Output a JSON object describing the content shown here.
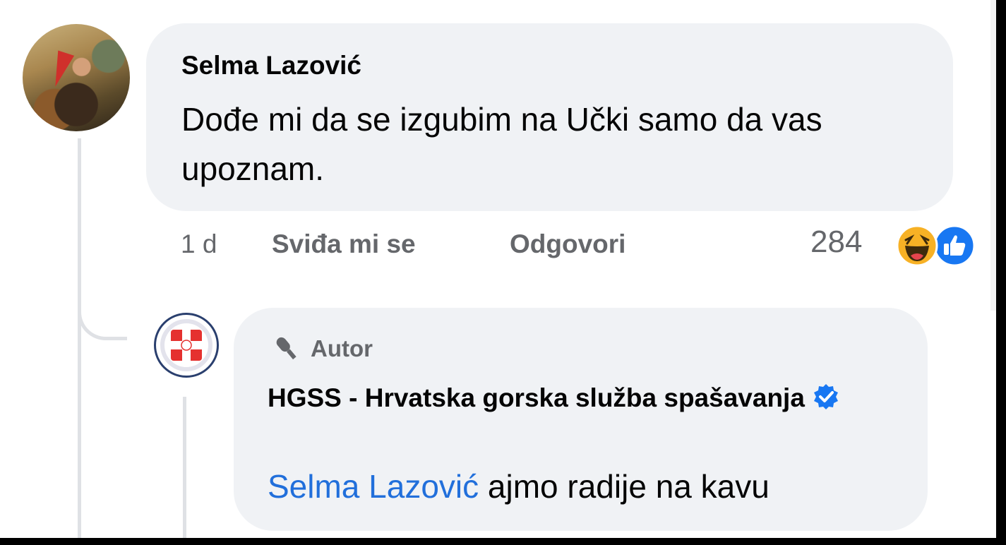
{
  "comment": {
    "author": "Selma Lazović",
    "text": "Dođe mi da se izgubim na Učki samo da vas upoznam.",
    "time": "1 d",
    "like_label": "Sviđa mi se",
    "reply_label": "Odgovori",
    "reaction_count": "284",
    "reactions": [
      "haha-icon",
      "like-icon"
    ]
  },
  "reply": {
    "badge": "Autor",
    "author": "HGSS - Hrvatska gorska služba spašavanja",
    "verified": true,
    "mention": "Selma Lazović",
    "text": " ajmo radije na kavu"
  },
  "colors": {
    "bubble": "#f0f2f5",
    "text": "#050505",
    "muted": "#65676b",
    "mention": "#216fdb",
    "like_blue": "#1877f2",
    "haha_yellow": "#f7b125"
  }
}
